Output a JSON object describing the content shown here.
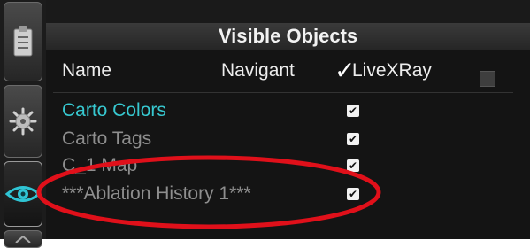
{
  "panel": {
    "title": "Visible Objects"
  },
  "header": {
    "name": "Name",
    "navigant": "Navigant",
    "livexray_check": "✓",
    "livexray": "LiveXRay"
  },
  "sidebar": {
    "tabs": [
      "clipboard-icon",
      "gear-icon",
      "eye-icon",
      "tab-icon"
    ]
  },
  "rows": [
    {
      "name": "Carto Colors",
      "checked": true
    },
    {
      "name": "Carto Tags",
      "checked": true
    },
    {
      "name": "C_1 Map",
      "checked": true
    },
    {
      "name": "***Ablation History 1***",
      "checked": true
    }
  ],
  "checkbox_mark": "✔",
  "colors": {
    "accent": "#37c8d0",
    "highlight": "#e0101a"
  }
}
